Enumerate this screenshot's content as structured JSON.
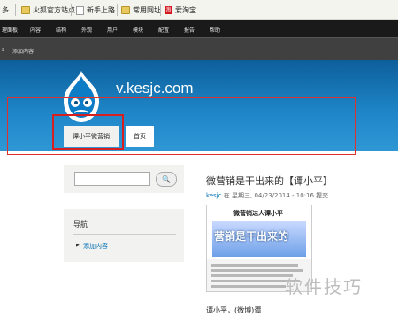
{
  "bookmarks": [
    {
      "label": "多",
      "icon": "none"
    },
    {
      "label": "火狐官方站点",
      "icon": "folder"
    },
    {
      "label": "新手上路",
      "icon": "page"
    },
    {
      "label": "常用网址",
      "icon": "folder"
    },
    {
      "label": "爱淘宝",
      "icon": "taobao"
    }
  ],
  "admin_menu": [
    "理面板",
    "内容",
    "结构",
    "外观",
    "用户",
    "模块",
    "配置",
    "报告",
    "帮助"
  ],
  "shortcut": "添加内容",
  "header": {
    "site_name": "v.kesjc.com"
  },
  "tabs": [
    {
      "label": "谭小平微营销"
    },
    {
      "label": "首页"
    }
  ],
  "search": {
    "button": "🔍"
  },
  "nav_block": {
    "title": "导航",
    "link": "添加内容"
  },
  "article": {
    "title": "微营销是干出来的【谭小平】",
    "author": "kesjc",
    "meta_rest": " 在 星期三, 04/23/2014 - 10:16 提交",
    "poster_head": "微营销达人谭小平",
    "poster_big": "营销是干出来的",
    "body_start": "谭小平，(微博)谭"
  },
  "watermark": "软件技巧",
  "colors": {
    "accent": "#0071b3",
    "header_blue": "#1f87c9",
    "highlight_red": "#d81e1e"
  }
}
